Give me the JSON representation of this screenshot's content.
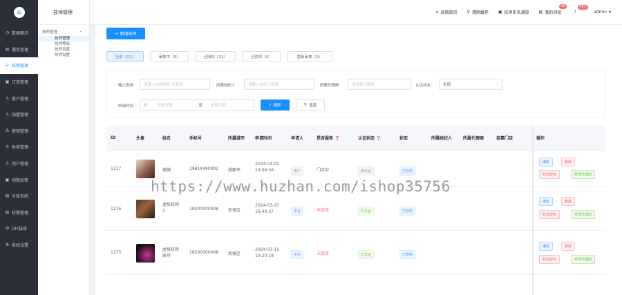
{
  "sidebar": {
    "items": [
      {
        "icon": "◔",
        "label": "数据概况"
      },
      {
        "icon": "▤",
        "label": "服务管理"
      },
      {
        "icon": "⊖",
        "label": "技师管理"
      },
      {
        "icon": "▣",
        "label": "订单管理"
      },
      {
        "icon": "♙",
        "label": "客户管理"
      },
      {
        "icon": "♙",
        "label": "加盟管理"
      },
      {
        "icon": "⁂",
        "label": "营销管理"
      },
      {
        "icon": "♔",
        "label": "财务管理"
      },
      {
        "icon": "♙",
        "label": "用户管理"
      },
      {
        "icon": "▣",
        "label": "问题反馈"
      },
      {
        "icon": "▤",
        "label": "分账系统"
      },
      {
        "icon": "▤",
        "label": "权限管理"
      },
      {
        "icon": "⊞",
        "label": "DIY装修"
      },
      {
        "icon": "⚙",
        "label": "系统设置"
      }
    ],
    "active_index": 2
  },
  "subnav": {
    "title": "技师管理",
    "group_label": "技师管理",
    "items": [
      "技师管理",
      "技师等级",
      "技师设置",
      "技师设置"
    ]
  },
  "topbar": {
    "home": "返回首页",
    "clear_cache": "清除缓存",
    "tech_notice": "技师实名通知",
    "my_notice": "我的消息",
    "my_notice_badge": "99",
    "bell_badge": "99+",
    "user": "admin"
  },
  "main": {
    "add_button": "+ 新增技师",
    "status_tabs": [
      "全部（21）",
      "审核中（0）",
      "已授权（21）",
      "已驳回（0）",
      "重新审核（0）"
    ],
    "filter": {
      "keyword_label": "输入查询",
      "keyword_placeholder": "请输入技师姓名/手机号",
      "agent_label": "所属经纪人",
      "agent_placeholder": "请输入经纪人姓名",
      "channel_label": "所属代理商",
      "channel_placeholder": "请选择代理商",
      "cert_label": "认证状态",
      "cert_value": "全部",
      "date_label": "申请时间",
      "date_start": "开始日期",
      "date_sep": "至",
      "date_end": "结束日期",
      "search_btn": "搜索",
      "reset_btn": "重置"
    },
    "table": {
      "headers": [
        "ID",
        "头像",
        "姓名",
        "手机号",
        "所属城市",
        "申请时间",
        "申请人",
        "是否服务",
        "认证状态",
        "状态",
        "所属经纪人",
        "所属代理商",
        "挂靠门店",
        "操作"
      ],
      "rows": [
        {
          "id": "1217",
          "name": "微微",
          "phone": "19814490002",
          "city": "成都市",
          "time1": "2024-04-01",
          "time2": "23:08:56",
          "applicant": "用户",
          "serving": "门店中",
          "cert": "未认证",
          "status": "已授权",
          "ops": [
            "编辑",
            "删除",
            "取消授权",
            "修改代理商"
          ]
        },
        {
          "id": "1216",
          "name": "虚拟技师",
          "name2": "2",
          "phone": "18200000008",
          "city": "武侯区",
          "time1": "2024-03-15",
          "time2": "16:40:37",
          "applicant": "平台",
          "serving": "未接单",
          "cert": "已认证",
          "status": "已授权",
          "ops": [
            "编辑",
            "删除",
            "取消授权",
            "修改代理商"
          ]
        },
        {
          "id": "1175",
          "name": "虚拟技师",
          "name2": "账号",
          "phone": "18200000008",
          "city": "武侯区",
          "time1": "2024-03-11",
          "time2": "10:20:18",
          "applicant": "平台",
          "serving": "未接单",
          "cert": "已认证",
          "status": "已授权",
          "ops": [
            "编辑",
            "删除",
            "取消授权",
            "修改代理商"
          ]
        }
      ]
    }
  },
  "watermark": "https://www.huzhan.com/ishop35756",
  "colors": {
    "primary": "#1890ff",
    "sidebar": "#2b2f3a",
    "danger": "#f56c6c",
    "success": "#67c23a"
  }
}
